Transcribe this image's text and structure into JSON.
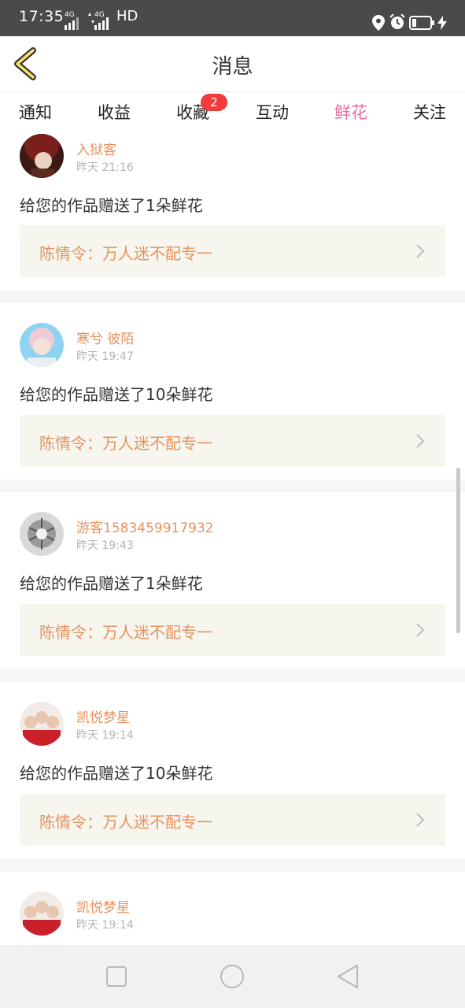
{
  "status_bar": {
    "time": "17:35",
    "net1": "4G",
    "net2": "4G",
    "hd": "HD",
    "icons": [
      "location-icon",
      "alarm-icon",
      "battery-icon",
      "charging-icon"
    ]
  },
  "header": {
    "title": "消息",
    "back_icon": "chevron-left-icon"
  },
  "tabs": [
    {
      "label": "通知"
    },
    {
      "label": "收益"
    },
    {
      "label": "收藏",
      "badge": "2"
    },
    {
      "label": "互动"
    },
    {
      "label": "鲜花",
      "active": true
    },
    {
      "label": "关注"
    }
  ],
  "colors": {
    "accent": "#e86fa0",
    "username": "#e8925e",
    "badge": "#f23c3c"
  },
  "messages": [
    {
      "username": "入狱客",
      "time": "昨天 21:16",
      "text": "给您的作品赠送了1朵鲜花",
      "work": "陈情令：万人迷不配专一"
    },
    {
      "username": "寒兮 彼陌",
      "time": "昨天 19:47",
      "text": "给您的作品赠送了10朵鲜花",
      "work": "陈情令：万人迷不配专一"
    },
    {
      "username": "游客1583459917932",
      "time": "昨天 19:43",
      "text": "给您的作品赠送了1朵鲜花",
      "work": "陈情令：万人迷不配专一"
    },
    {
      "username": "凯悦梦星",
      "time": "昨天 19:14",
      "text": "给您的作品赠送了10朵鲜花",
      "work": "陈情令：万人迷不配专一"
    },
    {
      "username": "凯悦梦星",
      "time": "昨天 19:14"
    }
  ],
  "nav": {
    "icons": [
      "recent-apps-icon",
      "home-icon",
      "back-icon"
    ]
  }
}
